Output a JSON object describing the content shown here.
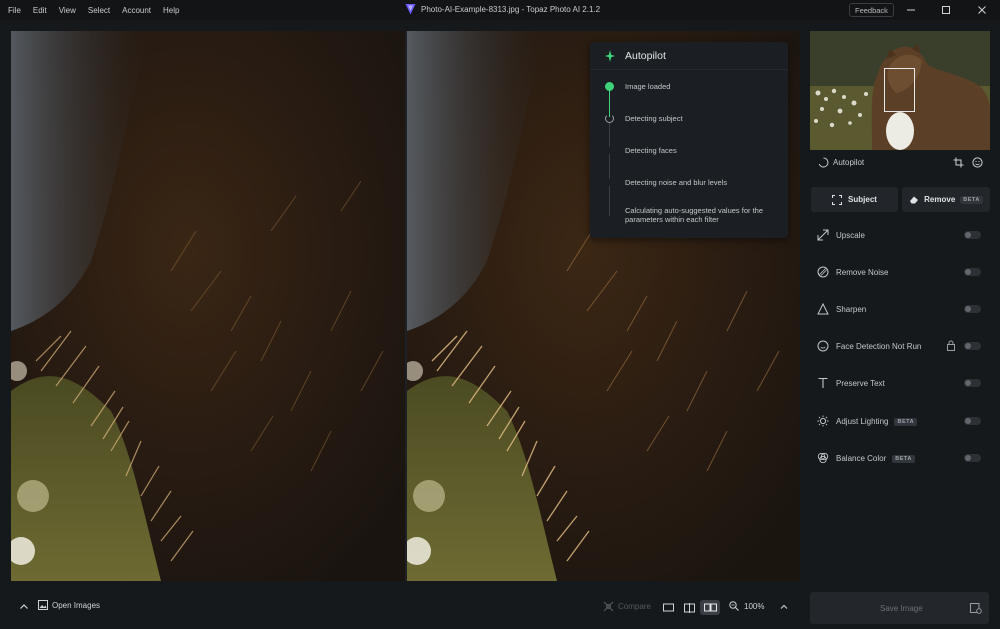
{
  "menu": [
    "File",
    "Edit",
    "View",
    "Select",
    "Account",
    "Help"
  ],
  "window": {
    "title": "Photo-AI-Example-8313.jpg - Topaz Photo AI 2.1.2",
    "feedback_label": "Feedback"
  },
  "autopilot_popup": {
    "title": "Autopilot",
    "steps": [
      {
        "label": "Image loaded",
        "status": "done"
      },
      {
        "label": "Detecting subject",
        "status": "in-progress"
      },
      {
        "label": "Detecting faces",
        "status": "pending"
      },
      {
        "label": "Detecting noise and blur levels",
        "status": "pending"
      },
      {
        "label": "Calculating auto-suggested values for the parameters within each filter",
        "status": "pending"
      }
    ]
  },
  "sidebar": {
    "autopilot_label": "Autopilot",
    "subject_label": "Subject",
    "remove_label": "Remove",
    "beta_label": "BETA",
    "filters": [
      {
        "name": "upscale",
        "label": "Upscale",
        "badge": "",
        "enabled": false
      },
      {
        "name": "remove-noise",
        "label": "Remove Noise",
        "badge": "",
        "enabled": false
      },
      {
        "name": "sharpen",
        "label": "Sharpen",
        "badge": "",
        "enabled": false
      },
      {
        "name": "face-detection",
        "label": "Face Detection Not Run",
        "badge": "",
        "enabled": false,
        "locked": true
      },
      {
        "name": "preserve-text",
        "label": "Preserve Text",
        "badge": "",
        "enabled": false
      },
      {
        "name": "adjust-lighting",
        "label": "Adjust Lighting",
        "badge": "BETA",
        "enabled": false
      },
      {
        "name": "balance-color",
        "label": "Balance Color",
        "badge": "BETA",
        "enabled": false
      }
    ]
  },
  "bottombar": {
    "open_images_label": "Open Images",
    "compare_label": "Compare",
    "zoom_label": "100%",
    "save_label": "Save Image"
  },
  "colors": {
    "accent_green": "#3fd27a",
    "background": "#16191c",
    "panel": "#22262a"
  }
}
